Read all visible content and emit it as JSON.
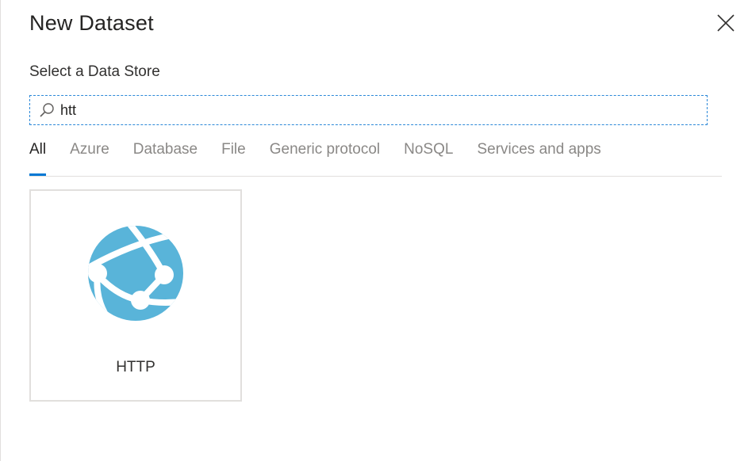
{
  "dialog": {
    "title": "New Dataset",
    "close_icon": "close-icon"
  },
  "store_picker": {
    "subtitle": "Select a Data Store",
    "search": {
      "value": "htt",
      "placeholder": "",
      "icon": "search-icon"
    },
    "tabs": [
      {
        "label": "All",
        "active": true
      },
      {
        "label": "Azure",
        "active": false
      },
      {
        "label": "Database",
        "active": false
      },
      {
        "label": "File",
        "active": false
      },
      {
        "label": "Generic protocol",
        "active": false
      },
      {
        "label": "NoSQL",
        "active": false
      },
      {
        "label": "Services and apps",
        "active": false
      }
    ],
    "results": [
      {
        "label": "HTTP",
        "icon": "globe-network-icon"
      }
    ]
  },
  "colors": {
    "accent": "#0078d4",
    "icon_blue": "#59b4d9",
    "tile_border": "#e1dfdd",
    "inactive_tab": "#8a8886"
  }
}
